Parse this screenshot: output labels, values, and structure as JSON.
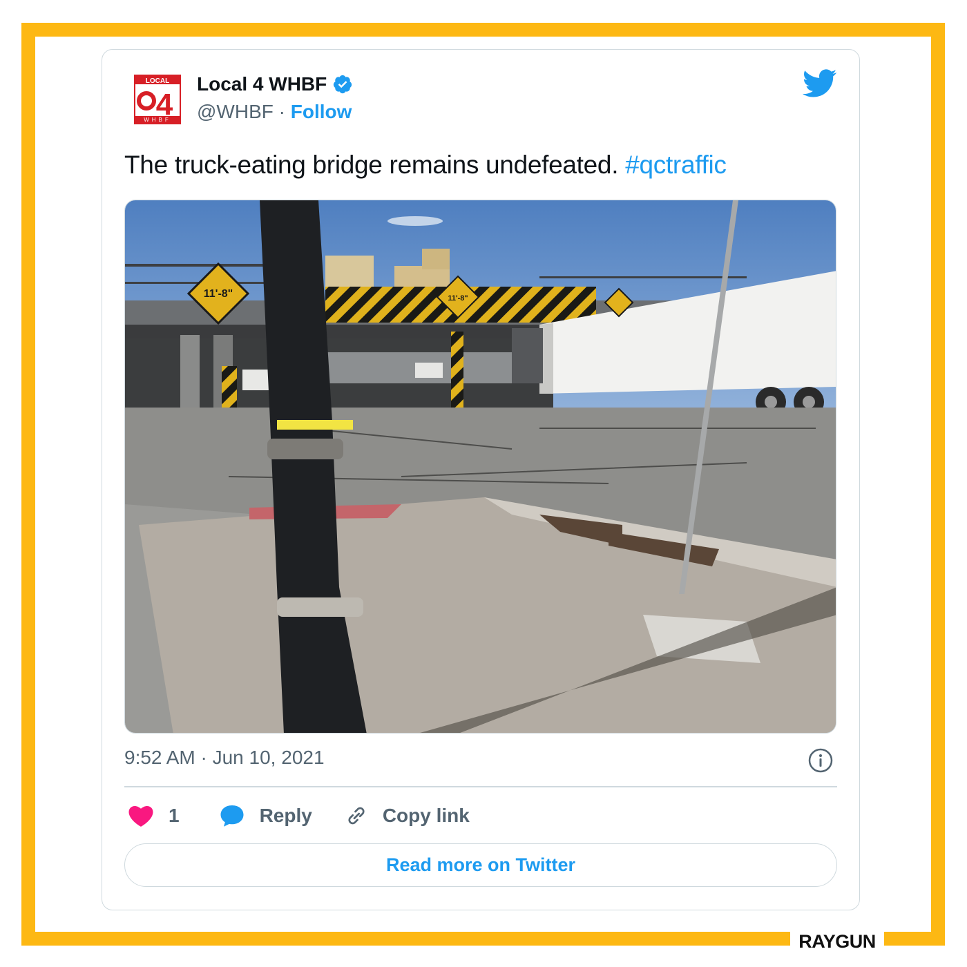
{
  "branding": {
    "label": "RAYGUN"
  },
  "tweet": {
    "author_name": "Local 4 WHBF",
    "handle": "@WHBF",
    "separator": " · ",
    "follow_label": "Follow",
    "avatar_text_top": "LOCAL",
    "avatar_number": "4",
    "avatar_text_bottom": "WHBF",
    "text": "The truck-eating bridge remains undefeated. ",
    "hashtag": "#qctraffic",
    "photo_signs": "11'-8\"",
    "timestamp": "9:52 AM · Jun 10, 2021",
    "likes_count": "1",
    "reply_label": "Reply",
    "copy_link_label": "Copy link",
    "read_more_label": "Read more on Twitter"
  },
  "icons": {
    "verified": "verified-badge-icon",
    "bird": "twitter-bird-icon",
    "info": "info-icon",
    "like": "heart-icon",
    "reply": "speech-bubble-icon",
    "link": "chain-link-icon"
  },
  "colors": {
    "frame": "#fdb813",
    "accent": "#1d9bf0",
    "heart": "#f91880",
    "text": "#0f1419",
    "muted": "#536471"
  }
}
